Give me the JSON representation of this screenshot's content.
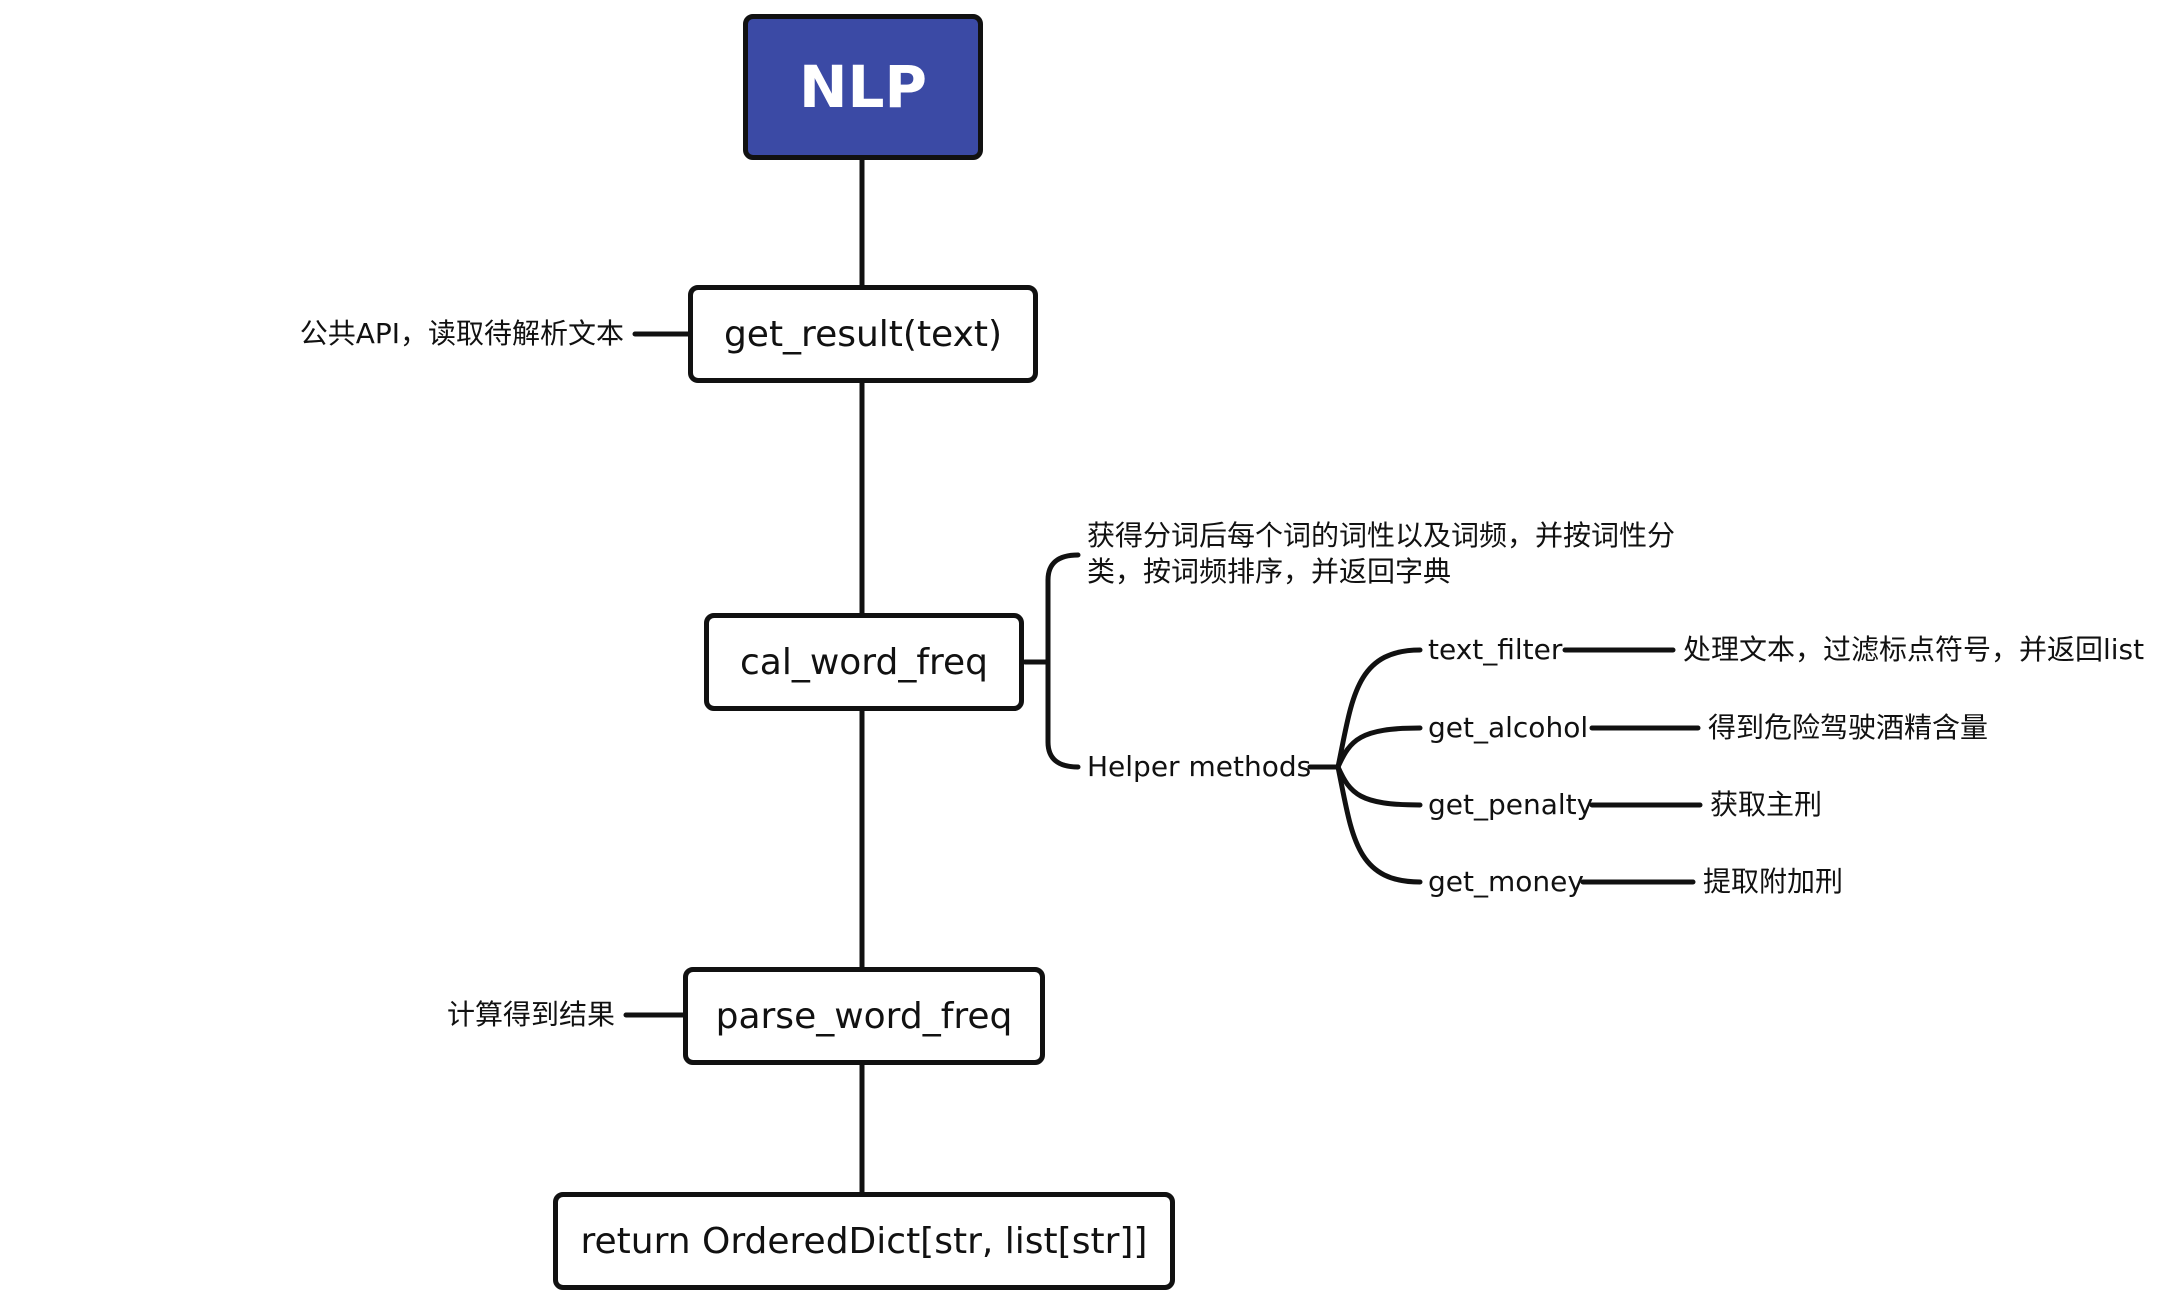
{
  "root": {
    "label": "NLP"
  },
  "nodes": {
    "get_result": "get_result(text)",
    "cal_word_freq": "cal_word_freq",
    "parse_word_freq": "parse_word_freq",
    "return": "return OrderedDict[str, list[str]]"
  },
  "annotations": {
    "get_result_note": "公共API，读取待解析文本",
    "cal_word_freq_note": "获得分词后每个词的词性以及词频，并按词性分类，按词频排序，并返回字典",
    "helper_methods": "Helper methods",
    "parse_word_freq_note": "计算得到结果"
  },
  "helpers": [
    {
      "name": "text_filter",
      "description": "处理文本，过滤标点符号，并返回list"
    },
    {
      "name": "get_alcohol",
      "description": "得到危险驾驶酒精含量"
    },
    {
      "name": "get_penalty",
      "description": "获取主刑"
    },
    {
      "name": "get_money",
      "description": "提取附加刑"
    }
  ],
  "colors": {
    "root_fill": "#3b4aa5",
    "stroke": "#111111",
    "background": "#ffffff"
  }
}
